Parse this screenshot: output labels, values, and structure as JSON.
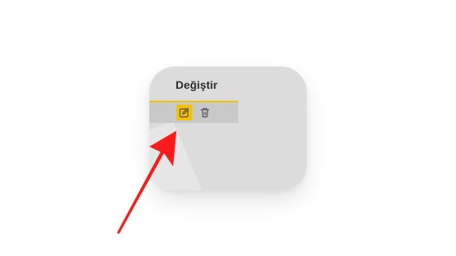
{
  "card": {
    "title": "Değiştir",
    "background_color": "#dcdcdc",
    "accent_color": "#f2c200"
  },
  "actions": [
    {
      "name": "edit",
      "icon": "edit-icon",
      "active": true
    },
    {
      "name": "delete",
      "icon": "trash-icon",
      "active": false
    }
  ],
  "annotation": {
    "type": "arrow",
    "color": "#ff1a1a",
    "points_to": "edit-button"
  }
}
